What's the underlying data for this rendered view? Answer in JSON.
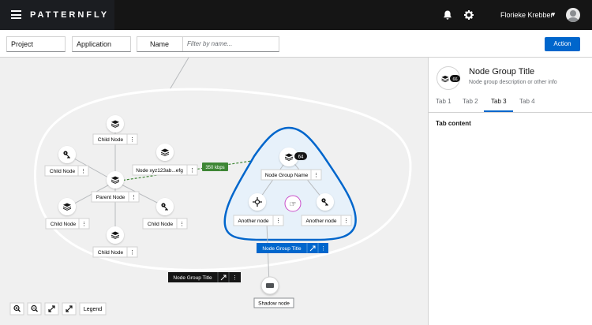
{
  "masthead": {
    "logo": "PATTERNFLY",
    "username": "Florieke Krebber",
    "icons": [
      "bell-icon",
      "gear-icon",
      "hamburger-icon",
      "caret-down-icon"
    ]
  },
  "toolbar": {
    "project_label": "Project",
    "application_label": "Application",
    "filter_label": "Name",
    "filter_placeholder": "Filter by name...",
    "action_label": "Action"
  },
  "panel": {
    "badge": "66",
    "title": "Node Group Title",
    "description": "Node group description or other info",
    "tabs": [
      "Tab 1",
      "Tab 2",
      "Tab 3",
      "Tab 4"
    ],
    "active_tab": "Tab 3",
    "content": "Tab content"
  },
  "topology": {
    "edge_label": "350 kbps",
    "nodes": {
      "child_top": "Child Node",
      "child_left": "Child Node",
      "xyz": "Node xyz123ab...efg",
      "parent": "Parent Node",
      "child_bl": "Child Node",
      "child_br": "Child Node",
      "child_bottom": "Child Node",
      "group_node": "Node Group Name",
      "group_badge": "64",
      "another_left": "Another node",
      "another_right": "Another node",
      "shadow": "Shadow node"
    },
    "group_title_blue": "Node Group Title",
    "group_title_dark": "Node Group Title",
    "legend": "Legend",
    "controls": [
      "zoom-in-icon",
      "zoom-out-icon",
      "fit-to-screen-icon",
      "expand-icon"
    ]
  },
  "colors": {
    "accent": "#0066cc",
    "masthead": "#151515",
    "edge_green": "#3e8635",
    "group_fill": "#e7f1fa",
    "selected_ring": "#c94ec9"
  }
}
